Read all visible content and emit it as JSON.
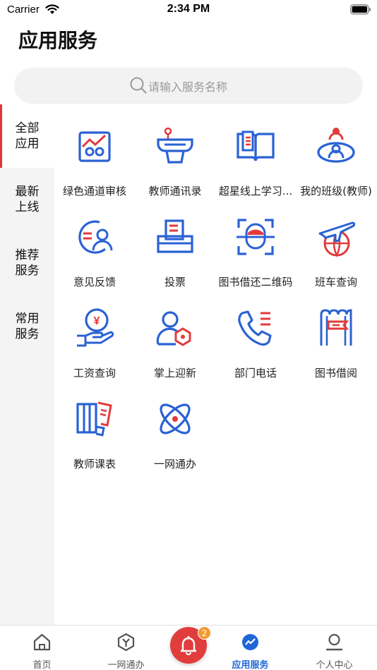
{
  "status": {
    "carrier": "Carrier",
    "time": "2:34 PM"
  },
  "page": {
    "title": "应用服务"
  },
  "search": {
    "placeholder": "请输入服务名称"
  },
  "sidebar": {
    "items": [
      {
        "label": "全部应用",
        "active": true
      },
      {
        "label": "最新上线",
        "active": false
      },
      {
        "label": "推荐服务",
        "active": false
      },
      {
        "label": "常用服务",
        "active": false
      }
    ]
  },
  "apps": [
    {
      "label": "绿色通道审核",
      "icon": "green-channel-icon"
    },
    {
      "label": "教师通讯录",
      "icon": "teacher-contacts-icon"
    },
    {
      "label": "超星线上学习...",
      "icon": "online-study-icon"
    },
    {
      "label": "我的班级(教师)",
      "icon": "my-class-icon"
    },
    {
      "label": "意见反馈",
      "icon": "feedback-icon"
    },
    {
      "label": "投票",
      "icon": "vote-icon"
    },
    {
      "label": "图书借还二维码",
      "icon": "face-scan-icon"
    },
    {
      "label": "班车查询",
      "icon": "airplane-globe-icon"
    },
    {
      "label": "工资查询",
      "icon": "salary-icon"
    },
    {
      "label": "掌上迎新",
      "icon": "welcome-user-icon"
    },
    {
      "label": "部门电话",
      "icon": "phone-icon"
    },
    {
      "label": "图书借阅",
      "icon": "book-borrow-icon"
    },
    {
      "label": "教师课表",
      "icon": "schedule-icon"
    },
    {
      "label": "一网通办",
      "icon": "network-service-icon"
    }
  ],
  "tabbar": {
    "items": [
      {
        "label": "首页",
        "icon": "home-icon"
      },
      {
        "label": "一网通办",
        "icon": "hexagon-y-icon"
      },
      {
        "label": "应用服务",
        "icon": "app-service-icon",
        "active": true
      },
      {
        "label": "个人中心",
        "icon": "person-icon"
      }
    ],
    "notification_count": "2"
  },
  "colors": {
    "accent_blue": "#1f66d6",
    "accent_red": "#e23636",
    "badge_orange": "#f39a2f"
  }
}
